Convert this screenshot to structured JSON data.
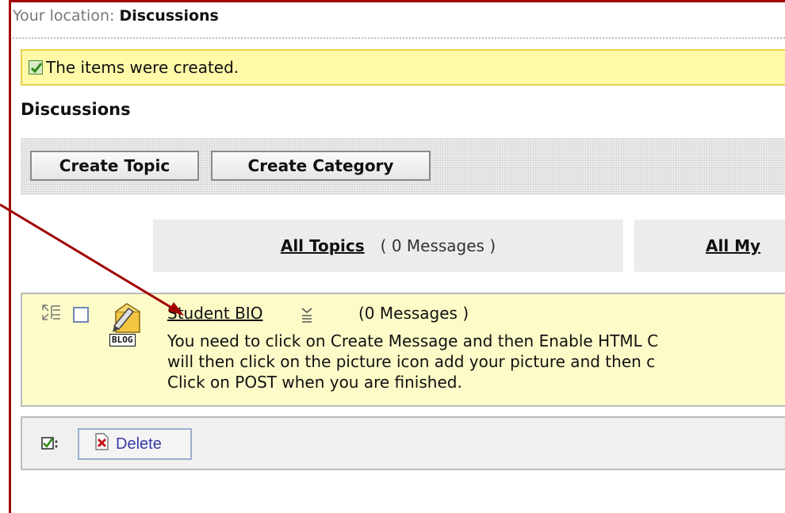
{
  "breadcrumb": {
    "label": "Your location: ",
    "current": "Discussions"
  },
  "notice": {
    "text": "The items were created."
  },
  "page_title": "Discussions",
  "toolbar": {
    "create_topic": "Create Topic",
    "create_category": "Create Category"
  },
  "tabs": [
    {
      "label": "All Topics",
      "count": "( 0 Messages )"
    },
    {
      "label": "All My"
    }
  ],
  "topic": {
    "title": "Student BIO",
    "count": "(0 Messages )",
    "badge": "BLOG",
    "description": [
      "You need to click on Create Message and then Enable HTML C",
      "will then click on the picture icon   add your picture and then c",
      "Click on POST when you are finished."
    ]
  },
  "actions": {
    "delete": "Delete"
  },
  "colors": {
    "frame": "#a00000",
    "notice_bg": "#fff9a8",
    "topic_bg": "#fdfbc8",
    "link_blue": "#3a3aa8"
  }
}
